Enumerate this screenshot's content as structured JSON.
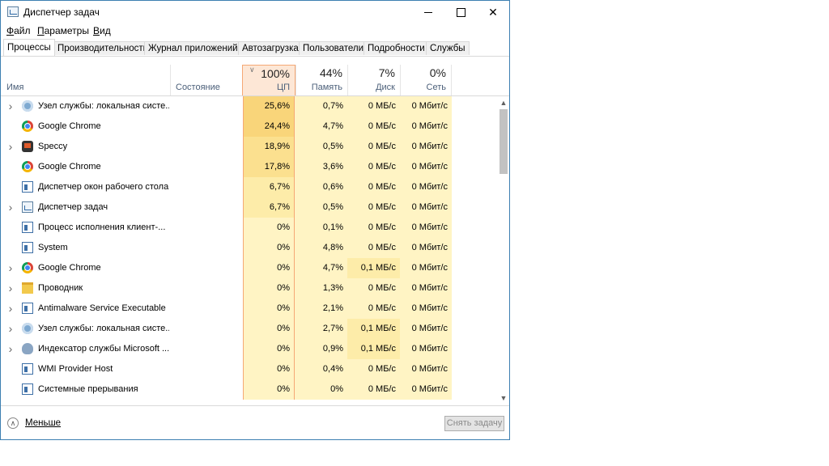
{
  "window": {
    "title": "Диспетчер задач",
    "controls": {
      "minimize": "minimize",
      "maximize": "maximize",
      "close": "✕"
    }
  },
  "menu": {
    "items": [
      {
        "label": "Файл",
        "underline": "Ф",
        "rest": "айл"
      },
      {
        "label": "Параметры",
        "underline": "П",
        "rest": "араметры"
      },
      {
        "label": "Вид",
        "underline": "В",
        "rest": "ид"
      }
    ]
  },
  "tabs": [
    {
      "label": "Процессы",
      "active": true
    },
    {
      "label": "Производительность",
      "active": false
    },
    {
      "label": "Журнал приложений",
      "active": false
    },
    {
      "label": "Автозагрузка",
      "active": false
    },
    {
      "label": "Пользователи",
      "active": false
    },
    {
      "label": "Подробности",
      "active": false
    },
    {
      "label": "Службы",
      "active": false
    }
  ],
  "columns": {
    "name": "Имя",
    "status": "Состояние",
    "cpu": {
      "pct": "100%",
      "label": "ЦП"
    },
    "memory": {
      "pct": "44%",
      "label": "Память"
    },
    "disk": {
      "pct": "7%",
      "label": "Диск"
    },
    "network": {
      "pct": "0%",
      "label": "Сеть"
    }
  },
  "processes": [
    {
      "name": "Узел службы: локальная систе...",
      "icon": "gear-icon",
      "expandable": true,
      "cpu": "25,6%",
      "mem": "0,7%",
      "disk": "0 МБ/с",
      "net": "0 Мбит/с",
      "cpu_bg": "#f9d57a",
      "mem_bg": "#fff4c4",
      "disk_bg": "#fff4c4",
      "net_bg": "#fff4c4"
    },
    {
      "name": "Google Chrome",
      "icon": "chrome-icon",
      "expandable": false,
      "cpu": "24,4%",
      "mem": "4,7%",
      "disk": "0 МБ/с",
      "net": "0 Мбит/с",
      "cpu_bg": "#f9d57a",
      "mem_bg": "#fff4c4",
      "disk_bg": "#fff4c4",
      "net_bg": "#fff4c4"
    },
    {
      "name": "Speccy",
      "icon": "speccy-icon",
      "expandable": true,
      "cpu": "18,9%",
      "mem": "0,5%",
      "disk": "0 МБ/с",
      "net": "0 Мбит/с",
      "cpu_bg": "#fbe08f",
      "mem_bg": "#fff4c4",
      "disk_bg": "#fff4c4",
      "net_bg": "#fff4c4"
    },
    {
      "name": "Google Chrome",
      "icon": "chrome-icon",
      "expandable": false,
      "cpu": "17,8%",
      "mem": "3,6%",
      "disk": "0 МБ/с",
      "net": "0 Мбит/с",
      "cpu_bg": "#fbe08f",
      "mem_bg": "#fff4c4",
      "disk_bg": "#fff4c4",
      "net_bg": "#fff4c4"
    },
    {
      "name": "Диспетчер окон рабочего стола",
      "icon": "window-icon",
      "expandable": false,
      "cpu": "6,7%",
      "mem": "0,6%",
      "disk": "0 МБ/с",
      "net": "0 Мбит/с",
      "cpu_bg": "#fdeca9",
      "mem_bg": "#fff4c4",
      "disk_bg": "#fff4c4",
      "net_bg": "#fff4c4"
    },
    {
      "name": "Диспетчер задач",
      "icon": "taskmgr-icon",
      "expandable": true,
      "cpu": "6,7%",
      "mem": "0,5%",
      "disk": "0 МБ/с",
      "net": "0 Мбит/с",
      "cpu_bg": "#fdeca9",
      "mem_bg": "#fff4c4",
      "disk_bg": "#fff4c4",
      "net_bg": "#fff4c4"
    },
    {
      "name": "Процесс исполнения клиент-...",
      "icon": "window-icon",
      "expandable": false,
      "cpu": "0%",
      "mem": "0,1%",
      "disk": "0 МБ/с",
      "net": "0 Мбит/с",
      "cpu_bg": "#fff4c4",
      "mem_bg": "#fff4c4",
      "disk_bg": "#fff4c4",
      "net_bg": "#fff4c4"
    },
    {
      "name": "System",
      "icon": "window-icon",
      "expandable": false,
      "cpu": "0%",
      "mem": "4,8%",
      "disk": "0 МБ/с",
      "net": "0 Мбит/с",
      "cpu_bg": "#fff4c4",
      "mem_bg": "#fff4c4",
      "disk_bg": "#fff4c4",
      "net_bg": "#fff4c4"
    },
    {
      "name": "Google Chrome",
      "icon": "chrome-icon",
      "expandable": true,
      "cpu": "0%",
      "mem": "4,7%",
      "disk": "0,1 МБ/с",
      "net": "0 Мбит/с",
      "cpu_bg": "#fff4c4",
      "mem_bg": "#fff4c4",
      "disk_bg": "#fdeca9",
      "net_bg": "#fff4c4"
    },
    {
      "name": "Проводник",
      "icon": "folder-icon",
      "expandable": true,
      "cpu": "0%",
      "mem": "1,3%",
      "disk": "0 МБ/с",
      "net": "0 Мбит/с",
      "cpu_bg": "#fff4c4",
      "mem_bg": "#fff4c4",
      "disk_bg": "#fff4c4",
      "net_bg": "#fff4c4"
    },
    {
      "name": "Antimalware Service Executable",
      "icon": "window-icon",
      "expandable": true,
      "cpu": "0%",
      "mem": "2,1%",
      "disk": "0 МБ/с",
      "net": "0 Мбит/с",
      "cpu_bg": "#fff4c4",
      "mem_bg": "#fff4c4",
      "disk_bg": "#fff4c4",
      "net_bg": "#fff4c4"
    },
    {
      "name": "Узел службы: локальная систе...",
      "icon": "gear-icon",
      "expandable": true,
      "cpu": "0%",
      "mem": "2,7%",
      "disk": "0,1 МБ/с",
      "net": "0 Мбит/с",
      "cpu_bg": "#fff4c4",
      "mem_bg": "#fff4c4",
      "disk_bg": "#fdeca9",
      "net_bg": "#fff4c4"
    },
    {
      "name": "Индексатор службы Microsoft ...",
      "icon": "indexer-icon",
      "expandable": true,
      "cpu": "0%",
      "mem": "0,9%",
      "disk": "0,1 МБ/с",
      "net": "0 Мбит/с",
      "cpu_bg": "#fff4c4",
      "mem_bg": "#fff4c4",
      "disk_bg": "#fdeca9",
      "net_bg": "#fff4c4"
    },
    {
      "name": "WMI Provider Host",
      "icon": "window-icon",
      "expandable": false,
      "cpu": "0%",
      "mem": "0,4%",
      "disk": "0 МБ/с",
      "net": "0 Мбит/с",
      "cpu_bg": "#fff4c4",
      "mem_bg": "#fff4c4",
      "disk_bg": "#fff4c4",
      "net_bg": "#fff4c4"
    },
    {
      "name": "Системные прерывания",
      "icon": "window-icon",
      "expandable": false,
      "cpu": "0%",
      "mem": "0%",
      "disk": "0 МБ/с",
      "net": "0 Мбит/с",
      "cpu_bg": "#fff4c4",
      "mem_bg": "#fff4c4",
      "disk_bg": "#fff4c4",
      "net_bg": "#fff4c4"
    }
  ],
  "footer": {
    "less_label": "Меньше",
    "end_task_label": "Снять задачу"
  },
  "scrollbar": {
    "up": "▲",
    "down": "▼"
  }
}
